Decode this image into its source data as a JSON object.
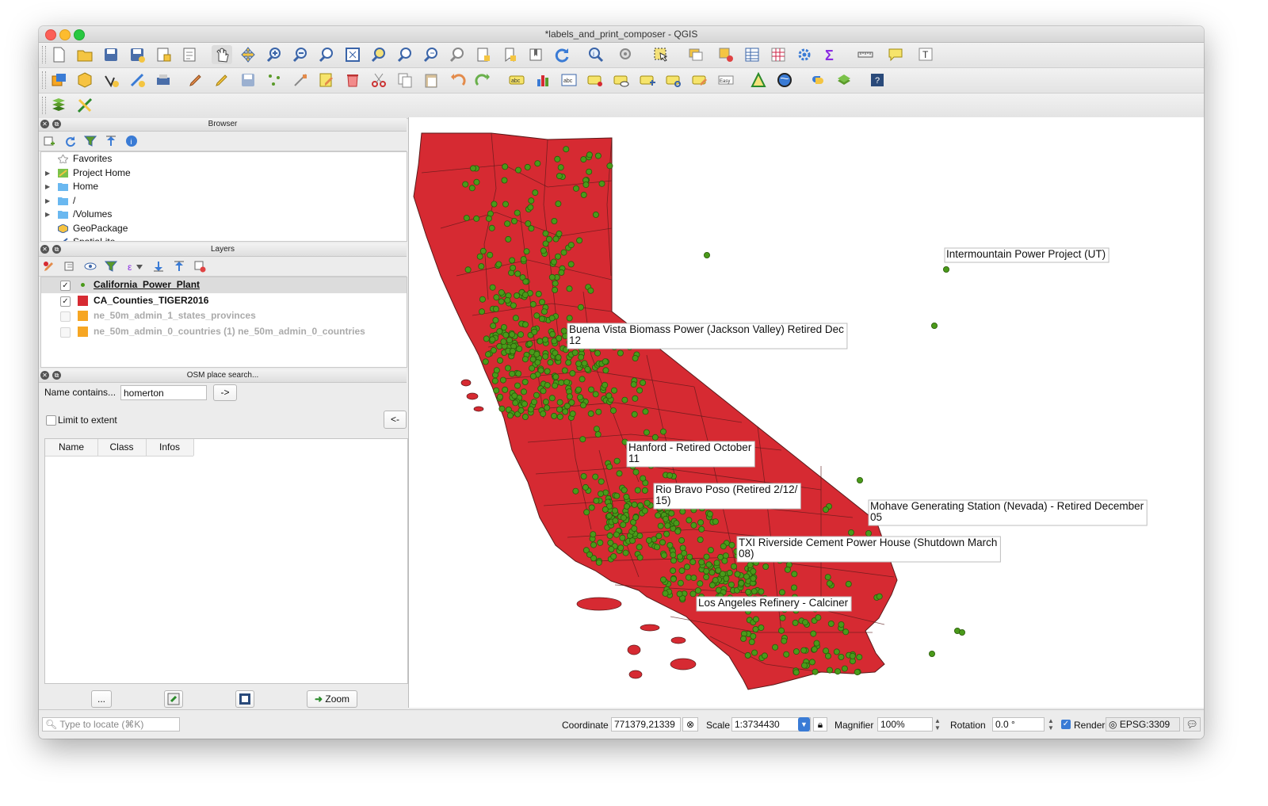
{
  "window": {
    "title": "*labels_and_print_composer - QGIS"
  },
  "browser": {
    "title": "Browser",
    "items": [
      {
        "label": "Favorites",
        "icon": "star-icon",
        "expandable": false
      },
      {
        "label": "Project Home",
        "icon": "project-home-icon",
        "expandable": true
      },
      {
        "label": "Home",
        "icon": "folder-icon",
        "expandable": true
      },
      {
        "label": "/",
        "icon": "folder-icon",
        "expandable": true
      },
      {
        "label": "/Volumes",
        "icon": "folder-icon",
        "expandable": true
      },
      {
        "label": "GeoPackage",
        "icon": "geopackage-icon",
        "expandable": false
      },
      {
        "label": "SpatiaLite",
        "icon": "spatialite-icon",
        "expandable": false
      }
    ]
  },
  "layers": {
    "title": "Layers",
    "items": [
      {
        "label": "California_Power_Plant",
        "checked": true,
        "enabled": true,
        "symbol": "point",
        "color": "#4a9a1a",
        "underline": true
      },
      {
        "label": "CA_Counties_TIGER2016",
        "checked": true,
        "enabled": true,
        "symbol": "fill",
        "color": "#d62a32",
        "underline": false
      },
      {
        "label": "ne_50m_admin_1_states_provinces",
        "checked": false,
        "enabled": false,
        "symbol": "fill",
        "color": "#f6a623",
        "underline": false
      },
      {
        "label": "ne_50m_admin_0_countries (1) ne_50m_admin_0_countries",
        "checked": false,
        "enabled": false,
        "symbol": "fill",
        "color": "#f6a623",
        "underline": false
      }
    ]
  },
  "osm": {
    "title": "OSM place search...",
    "name_label": "Name contains...",
    "name_value": "homerton",
    "go_label": "->",
    "limit_label": "Limit to extent",
    "back_label": "<-",
    "columns": [
      "Name",
      "Class",
      "Infos"
    ],
    "more_label": "...",
    "zoom_label": "Zoom"
  },
  "map": {
    "state_fill": "#d62a32",
    "point_color": "#4a9a1a",
    "labels": [
      {
        "lines": [
          "Intermountain Power Project (UT)"
        ]
      },
      {
        "lines": [
          "Buena Vista Biomass Power (Jackson Valley) Retired Dec",
          "12"
        ]
      },
      {
        "lines": [
          "Hanford - Retired October",
          "11"
        ]
      },
      {
        "lines": [
          "Rio Bravo Poso (Retired 2/12/",
          "15)"
        ]
      },
      {
        "lines": [
          "Mohave Generating Station (Nevada) - Retired December",
          "05"
        ]
      },
      {
        "lines": [
          "TXI Riverside Cement Power House (Shutdown March",
          "08)"
        ]
      },
      {
        "lines": [
          "Los Angeles Refinery - Calciner"
        ]
      }
    ]
  },
  "statusbar": {
    "locate_placeholder": "Type to locate (⌘K)",
    "coordinate_label": "Coordinate",
    "coordinate_value": "771379,21339",
    "scale_label": "Scale",
    "scale_value": "1:3734430",
    "magnifier_label": "Magnifier",
    "magnifier_value": "100%",
    "rotation_label": "Rotation",
    "rotation_value": "0.0 °",
    "render_label": "Render",
    "render_checked": true,
    "crs_label": "EPSG:3309"
  }
}
